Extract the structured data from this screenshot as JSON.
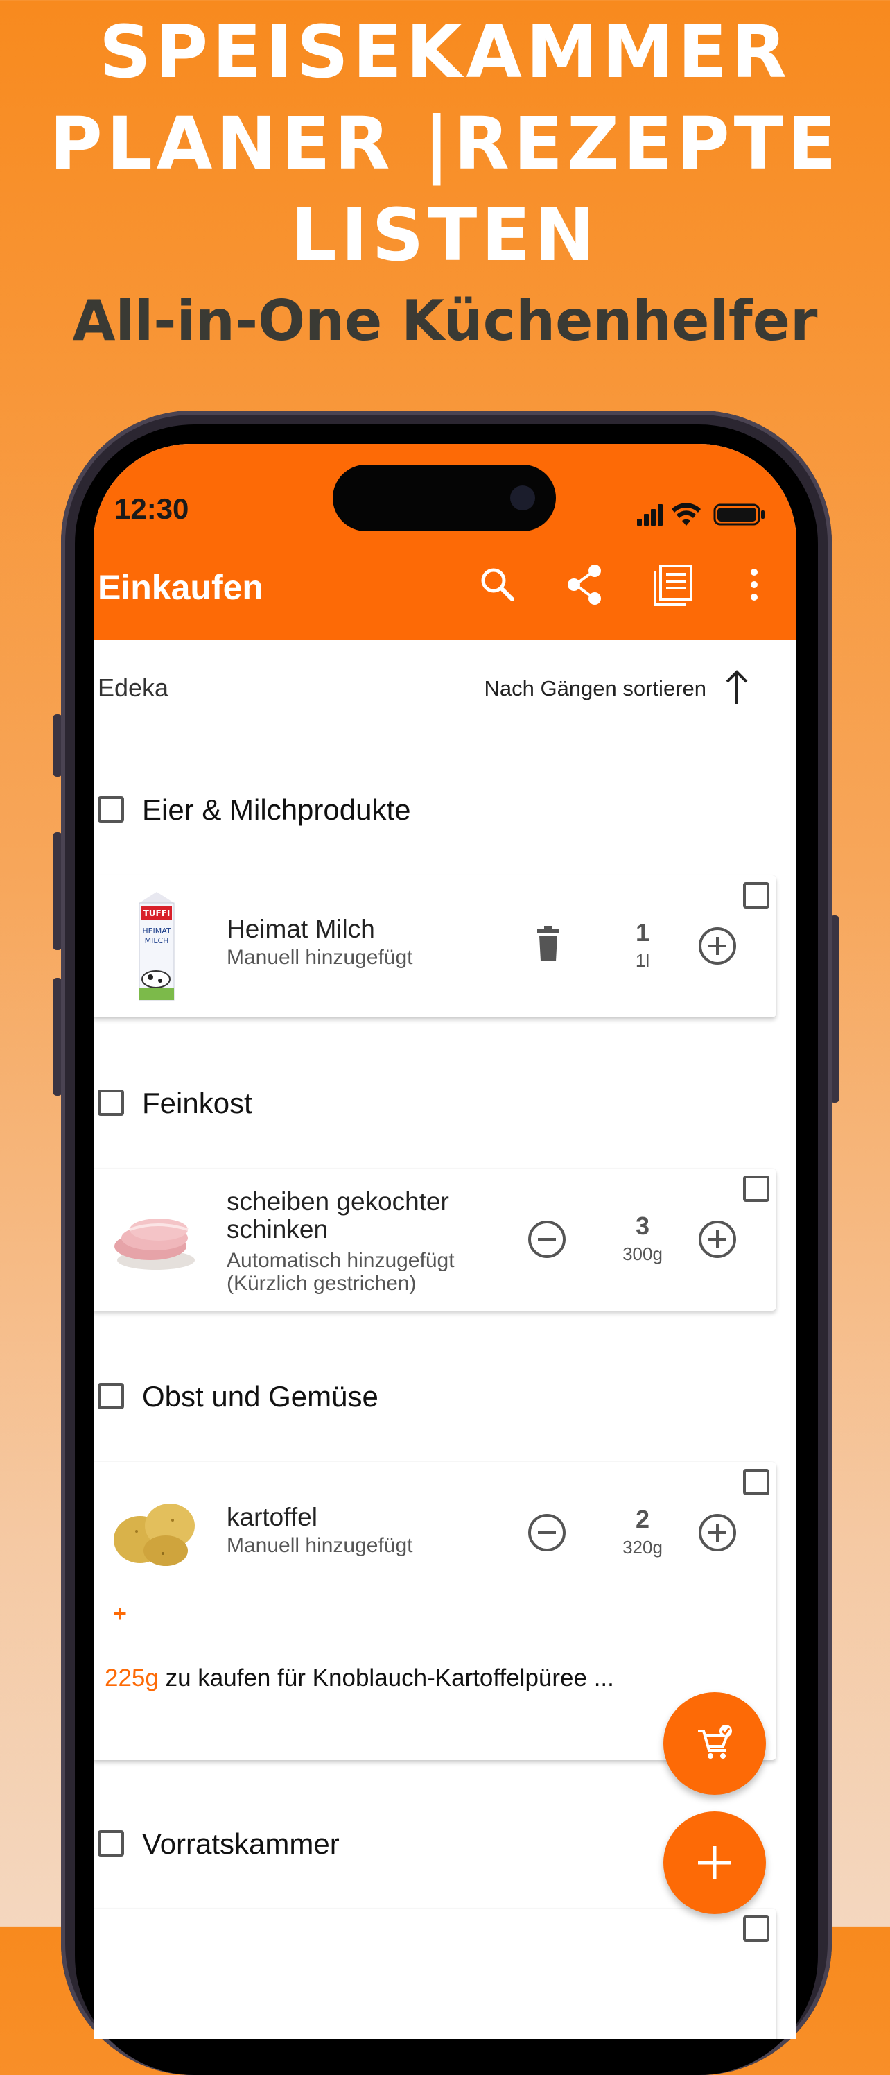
{
  "hero": {
    "line1": "SPEISEKAMMER",
    "line2": "PLANER |REZEPTE",
    "line3": "LISTEN",
    "subtitle": "All-in-One Küchenhelfer"
  },
  "status_bar": {
    "time": "12:30"
  },
  "app_bar": {
    "title": "Einkaufen",
    "icons": [
      "search-icon",
      "share-icon",
      "list-icon",
      "more-vert-icon"
    ],
    "color": "#fd6a06"
  },
  "store": {
    "name": "Edeka",
    "sort_label": "Nach Gängen sortieren"
  },
  "categories": [
    {
      "label": "Eier & Milchprodukte",
      "items": [
        {
          "name": "Heimat Milch",
          "source": "Manuell hinzugefügt",
          "qty": "1",
          "unit": "1l"
        }
      ]
    },
    {
      "label": "Feinkost",
      "items": [
        {
          "name": "scheiben gekochter schinken",
          "source": "Automatisch hinzugefügt (Kürzlich gestrichen)",
          "qty": "3",
          "unit": "300g"
        }
      ]
    },
    {
      "label": "Obst und Gemüse",
      "items": [
        {
          "name": "kartoffel",
          "source": "Manuell hinzugefügt",
          "qty": "2",
          "unit": "320g",
          "recipe_amount": "225g",
          "recipe_text": "zu kaufen für Knoblauch-Kartoffelpüree ...",
          "add_symbol": "+"
        }
      ]
    },
    {
      "label": "Vorratskammer",
      "items": []
    }
  ],
  "milk_carton": {
    "brand": "TUFFI",
    "line1": "HEIMAT",
    "line2": "MILCH"
  },
  "fabs": [
    "cart-check-icon",
    "add-icon"
  ]
}
